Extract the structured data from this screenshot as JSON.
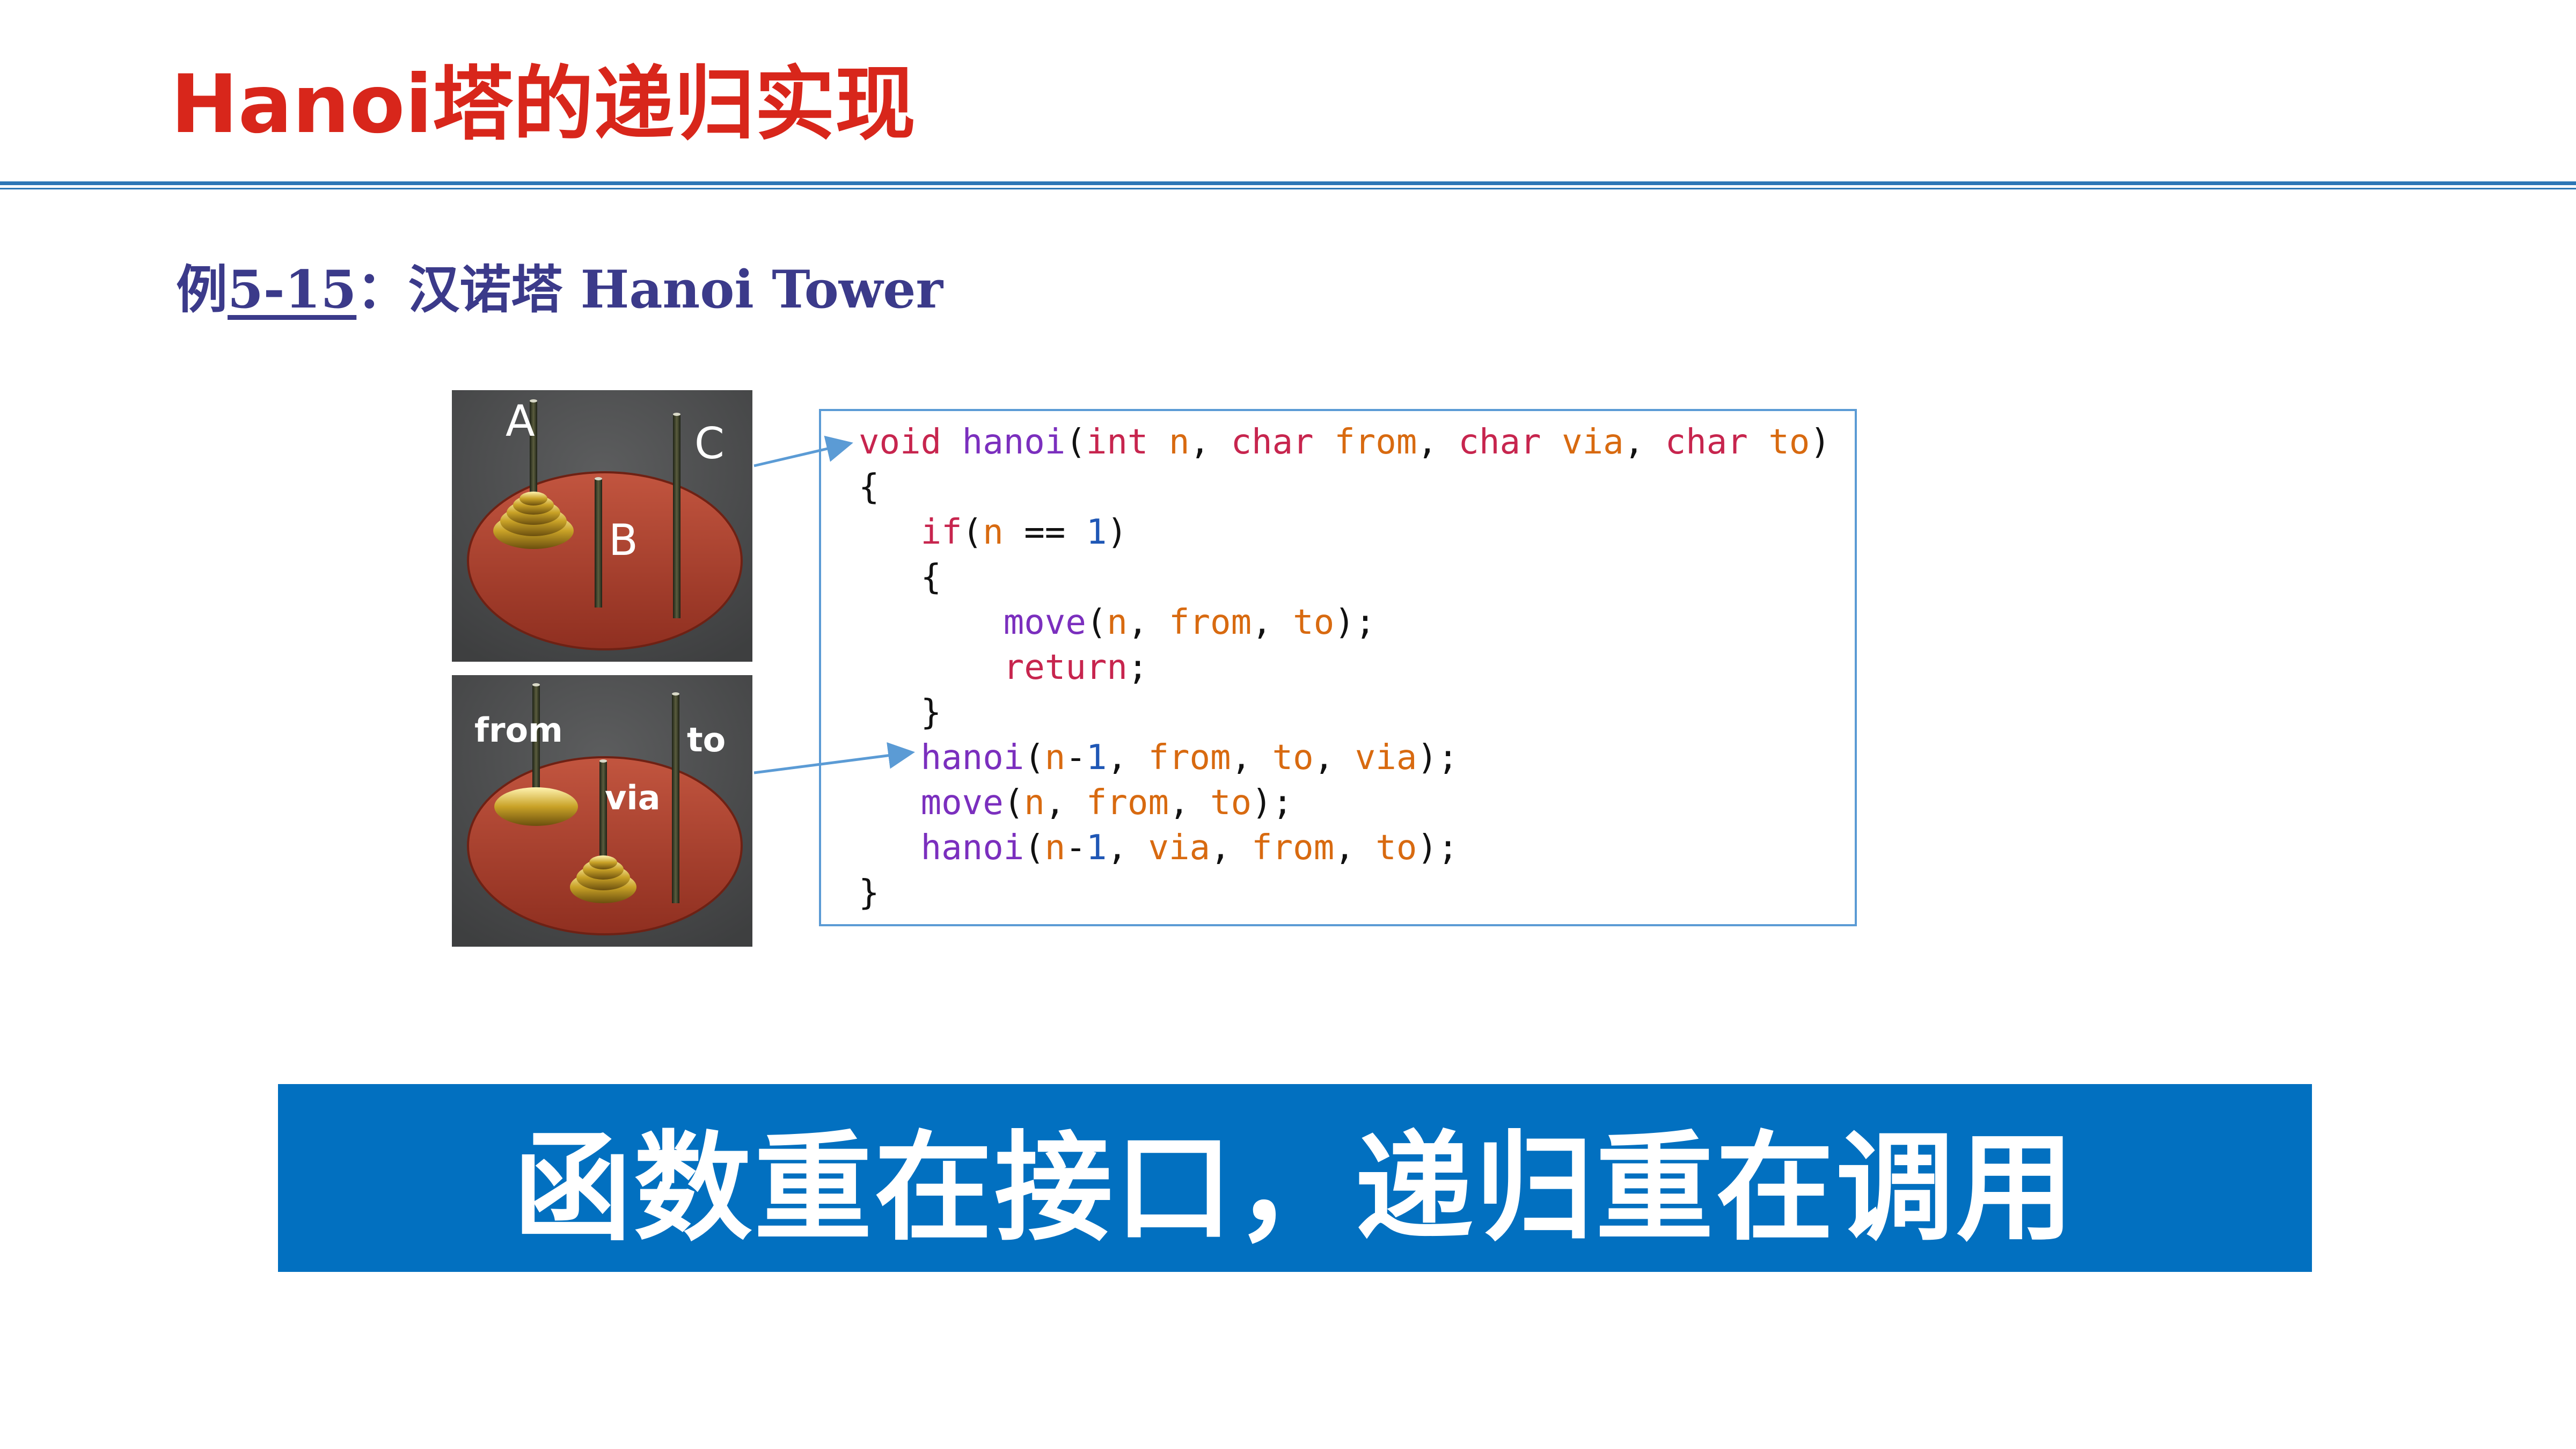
{
  "slide": {
    "title": "Hanoi塔的递归实现",
    "subtitle": {
      "prefix": "例",
      "number": "5-15",
      "suffix": "：汉诺塔 Hanoi Tower"
    },
    "photos": [
      {
        "labels": [
          "A",
          "B",
          "C"
        ]
      },
      {
        "labels": [
          "from",
          "via",
          "to"
        ]
      }
    ],
    "code": {
      "line1": {
        "void": "void",
        "name": "hanoi",
        "int": "int",
        "n": "n",
        "char1": "char",
        "from": "from",
        "char2": "char",
        "via": "via",
        "char3": "char",
        "to": "to"
      },
      "line2": "{",
      "line3": {
        "if": "if",
        "n": "n",
        "op": "==",
        "one": "1"
      },
      "line4": "{",
      "line5": {
        "move": "move",
        "n": "n",
        "from": "from",
        "to": "to"
      },
      "line6": "return",
      "line7": "}",
      "line8": {
        "hanoi": "hanoi",
        "n": "n",
        "one": "1",
        "from": "from",
        "to": "to",
        "via": "via"
      },
      "line9": {
        "move": "move",
        "n": "n",
        "from": "from",
        "to": "to"
      },
      "line10": {
        "hanoi": "hanoi",
        "n": "n",
        "one": "1",
        "via": "via",
        "from": "from",
        "to": "to"
      },
      "line11": "}"
    },
    "banner": "函数重在接口，递归重在调用"
  }
}
